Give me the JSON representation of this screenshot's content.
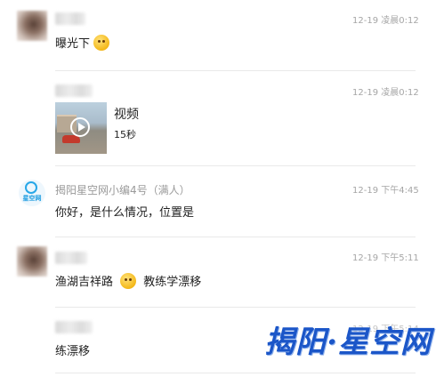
{
  "messages": [
    {
      "time": "12-19 凌晨0:12",
      "text": "曝光下",
      "emoji": "sweat-smile-emoji"
    },
    {
      "time": "12-19 凌晨0:12",
      "video": {
        "title": "视频",
        "duration": "15秒"
      }
    },
    {
      "name": "揭阳星空网小编4号（满人）",
      "time": "12-19 下午4:45",
      "text": "你好，是什么情况，位置是",
      "avatar_logo_text": "星空网"
    },
    {
      "time": "12-19 下午5:11",
      "text_before": "渔湖吉祥路",
      "text_after": "教练学漂移",
      "emoji": "cry-laugh-emoji"
    },
    {
      "time": "12-19 下午5:14",
      "text": "练漂移"
    }
  ],
  "watermark": "揭阳·星空网",
  "colors": {
    "watermark": "#1b56c8",
    "time": "#a6a6a6",
    "divider": "#e9e9e9"
  }
}
